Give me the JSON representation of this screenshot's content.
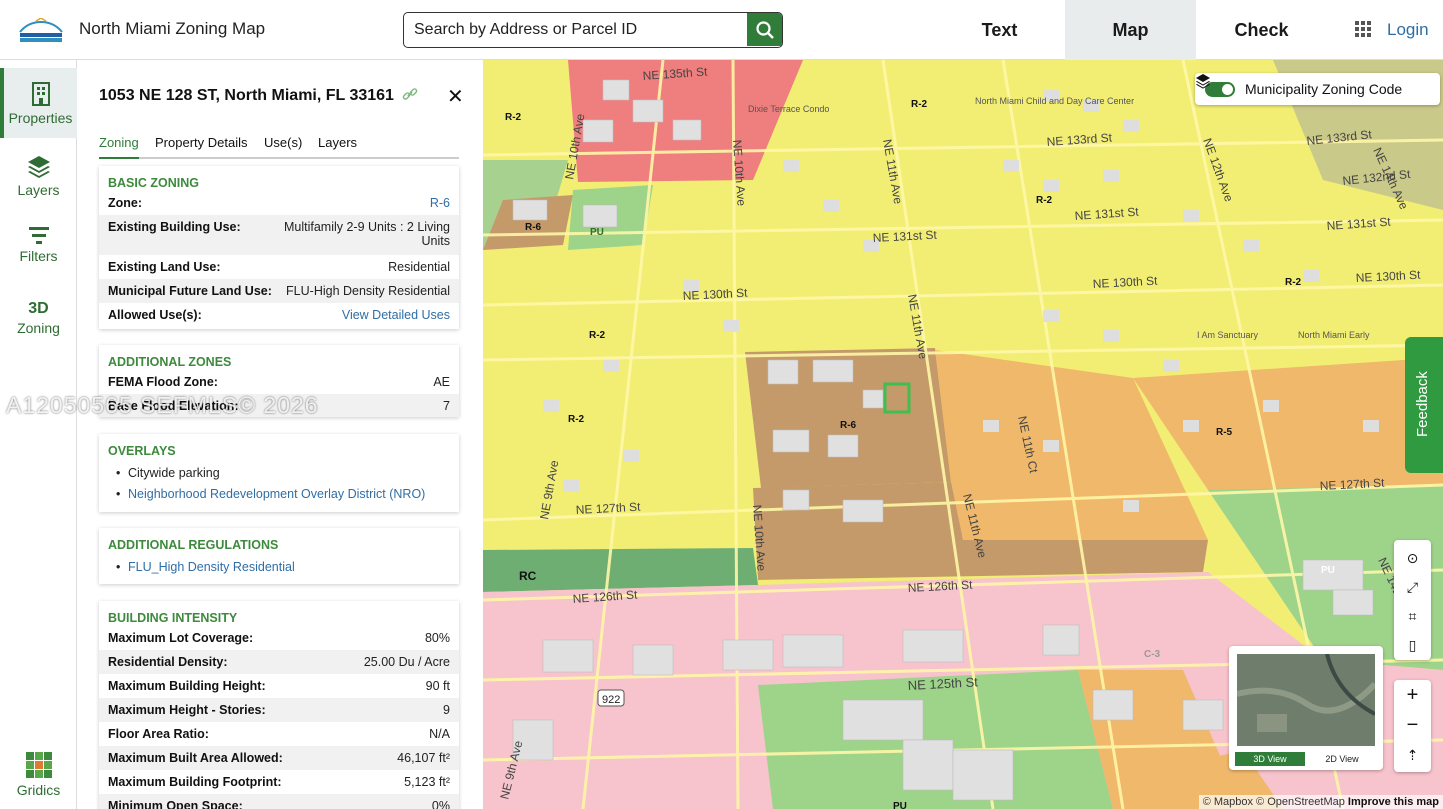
{
  "header": {
    "title": "North Miami Zoning Map",
    "search_placeholder": "Search by Address or Parcel ID",
    "tabs": [
      {
        "label": "Text"
      },
      {
        "label": "Map"
      },
      {
        "label": "Check"
      }
    ],
    "login": "Login",
    "accent": "#2f7d39"
  },
  "rail": {
    "items": [
      {
        "label": "Properties",
        "icon": "building-icon"
      },
      {
        "label": "Layers",
        "icon": "layers-icon"
      },
      {
        "label": "Filters",
        "icon": "filter-icon"
      },
      {
        "top": "3D",
        "label": "Zoning"
      },
      {
        "label": "Gridics",
        "icon": "gridics-logo-icon"
      }
    ]
  },
  "panel": {
    "address": "1053 NE 128 ST, North Miami, FL 33161",
    "tabs": [
      "Zoning",
      "Property Details",
      "Use(s)",
      "Layers"
    ],
    "basic": {
      "title": "BASIC ZONING",
      "zone_k": "Zone:",
      "zone_v": "R-6",
      "bu_k": "Existing Building Use:",
      "bu_v1": "Multifamily 2-9 Units : 2 Living",
      "bu_v2": "Units",
      "lu_k": "Existing Land Use:",
      "lu_v": "Residential",
      "flu_k": "Municipal Future Land Use:",
      "flu_v": "FLU-High Density Residential",
      "au_k": "Allowed Use(s):",
      "au_v": "View Detailed Uses"
    },
    "additional": {
      "title": "ADDITIONAL ZONES",
      "fema_k": "FEMA Flood Zone:",
      "fema_v": "AE",
      "bfe_k": "Base Flood Elevation:",
      "bfe_v": "7"
    },
    "overlays": {
      "title": "OVERLAYS",
      "items": [
        "Citywide parking",
        "Neighborhood Redevelopment Overlay District (NRO)"
      ]
    },
    "regulations": {
      "title": "ADDITIONAL REGULATIONS",
      "items": [
        "FLU_High Density Residential"
      ]
    },
    "intensity": {
      "title": "BUILDING INTENSITY",
      "rows": [
        {
          "k": "Maximum Lot Coverage:",
          "v": "80%"
        },
        {
          "k": "Residential Density:",
          "v": "25.00 Du / Acre"
        },
        {
          "k": "Maximum Building Height:",
          "v": "90 ft"
        },
        {
          "k": "Maximum Height - Stories:",
          "v": "9"
        },
        {
          "k": "Floor Area Ratio:",
          "v": "N/A"
        },
        {
          "k": "Maximum Built Area Allowed:",
          "v": "46,107 ft²"
        },
        {
          "k": "Maximum Building Footprint:",
          "v": "5,123 ft²"
        },
        {
          "k": "Minimum Open Space:",
          "v": "0%"
        }
      ]
    }
  },
  "map": {
    "layer_label": "Municipality Zoning Code",
    "feedback": "Feedback",
    "view_3d": "3D View",
    "view_2d": "2D View",
    "attribution": "© Mapbox © OpenStreetMap",
    "improve": "Improve this map",
    "zones": {
      "r2": "R-2",
      "r5": "R-5",
      "r6": "R-6",
      "rc": "RC",
      "pu": "PU",
      "c3": "C-3"
    },
    "streets": {
      "s135": "NE 135th St",
      "s133": "NE 133rd St",
      "s132": "NE 132nd St",
      "s131": "NE 131st St",
      "s130": "NE 130th St",
      "s127": "NE 127th St",
      "s126": "NE 126th St",
      "s125": "NE 125th St",
      "a9": "NE 9th Ave",
      "a10": "NE 10th Ave",
      "a11": "NE 11th Ave",
      "a11c": "NE 11th Ct",
      "a12": "NE 12th Ave",
      "a14": "NE 14th Ave",
      "route": "922"
    },
    "pois": [
      "Dixie Terrace Condo",
      "North Miami Child and Day Care Center",
      "North Miami Early",
      "I Am Sanctuary"
    ]
  },
  "watermark": "A12050565 SEFMLS© 2026"
}
